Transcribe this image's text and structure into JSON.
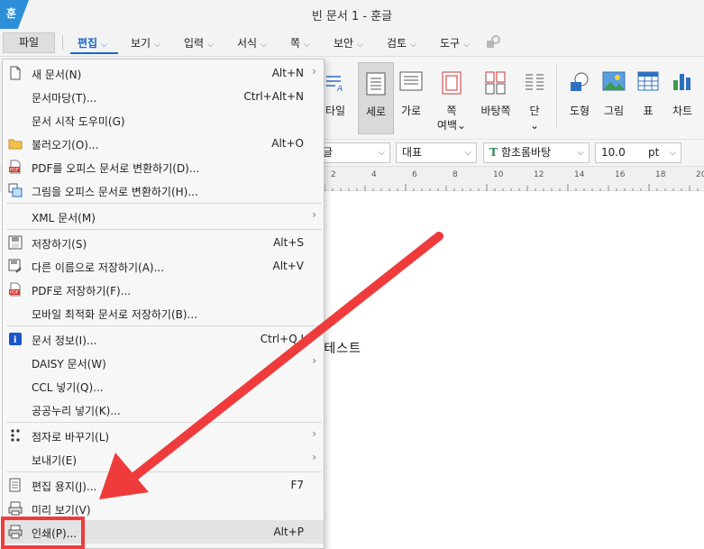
{
  "window": {
    "title": "빈 문서 1 - 훈글",
    "logo": "훈"
  },
  "menubar": {
    "file": "파일",
    "items": [
      {
        "label": "편집",
        "active": true,
        "caret": true
      },
      {
        "label": "보기",
        "caret": true
      },
      {
        "label": "입력",
        "caret": true
      },
      {
        "label": "서식",
        "caret": true
      },
      {
        "label": "쪽",
        "caret": true
      },
      {
        "label": "보안",
        "caret": true
      },
      {
        "label": "검토",
        "caret": true
      },
      {
        "label": "도구",
        "caret": true
      }
    ],
    "caret_glyph": "⌵"
  },
  "ribbon": {
    "items": [
      {
        "label": "타일"
      },
      {
        "label": "세로",
        "selected": true
      },
      {
        "label": "가로"
      },
      {
        "label": "쪽\n여백⌄"
      },
      {
        "label": "바탕쪽"
      },
      {
        "label": "단\n⌄"
      },
      {
        "label": "도형"
      },
      {
        "label": "그림"
      },
      {
        "label": "표"
      },
      {
        "label": "차트"
      }
    ]
  },
  "formatbar": {
    "style_value": "탕글",
    "para_style": "대표",
    "font": "함초롬바탕",
    "font_icon": "T",
    "size": "10.0",
    "unit": "pt",
    "dropdown_glyph": "⌵"
  },
  "ruler": {
    "labels": [
      "2",
      "4",
      "6",
      "8",
      "10",
      "12",
      "14",
      "16",
      "18",
      "20"
    ]
  },
  "document": {
    "text": "크 테스트"
  },
  "file_menu": {
    "items": [
      {
        "label": "새 문서(N)",
        "shortcut": "Alt+N",
        "submenu": true,
        "icon": "new-document-icon"
      },
      {
        "label": "문서마당(T)...",
        "shortcut": "Ctrl+Alt+N",
        "icon": ""
      },
      {
        "label": "문서 시작 도우미(G)",
        "shortcut": "",
        "icon": ""
      },
      {
        "label": "불러오기(O)...",
        "shortcut": "Alt+O",
        "icon": "folder-icon"
      },
      {
        "label": "PDF를 오피스 문서로 변환하기(D)...",
        "shortcut": "",
        "icon": "pdf-icon"
      },
      {
        "label": "그림을 오피스 문서로 변환하기(H)...",
        "shortcut": "",
        "icon": "image-convert-icon"
      },
      {
        "label": "XML 문서(M)",
        "shortcut": "",
        "submenu": true,
        "icon": "",
        "sep_before": true
      },
      {
        "label": "저장하기(S)",
        "shortcut": "Alt+S",
        "icon": "save-icon",
        "sep_before": true
      },
      {
        "label": "다른 이름으로 저장하기(A)...",
        "shortcut": "Alt+V",
        "icon": "save-as-icon"
      },
      {
        "label": "PDF로 저장하기(F)...",
        "shortcut": "",
        "icon": "pdf-icon"
      },
      {
        "label": "모바일 최적화 문서로 저장하기(B)...",
        "shortcut": "",
        "icon": ""
      },
      {
        "label": "문서 정보(I)...",
        "shortcut": "Ctrl+Q,I",
        "icon": "info-icon",
        "sep_before": true
      },
      {
        "label": "DAISY 문서(W)",
        "shortcut": "",
        "submenu": true,
        "icon": ""
      },
      {
        "label": "CCL 넣기(Q)...",
        "shortcut": "",
        "icon": ""
      },
      {
        "label": "공공누리 넣기(K)...",
        "shortcut": "",
        "icon": ""
      },
      {
        "label": "점자로 바꾸기(L)",
        "shortcut": "",
        "submenu": true,
        "icon": "braille-icon",
        "sep_before": true
      },
      {
        "label": "보내기(E)",
        "shortcut": "",
        "submenu": true,
        "icon": ""
      },
      {
        "label": "편집 용지(J)...",
        "shortcut": "F7",
        "icon": "page-setup-icon",
        "sep_before": true
      },
      {
        "label": "미리 보기(V)",
        "shortcut": "",
        "icon": "preview-icon"
      },
      {
        "label": "인쇄(P)...",
        "shortcut": "Alt+P",
        "icon": "printer-icon",
        "highlighted": true
      }
    ],
    "submenu_glyph": "›"
  },
  "annotation": {
    "box_color": "#ef3b3b",
    "arrow_color": "#ef3b3b"
  },
  "colors": {
    "accent": "#1a66c9",
    "logo": "#2e8fd9"
  }
}
